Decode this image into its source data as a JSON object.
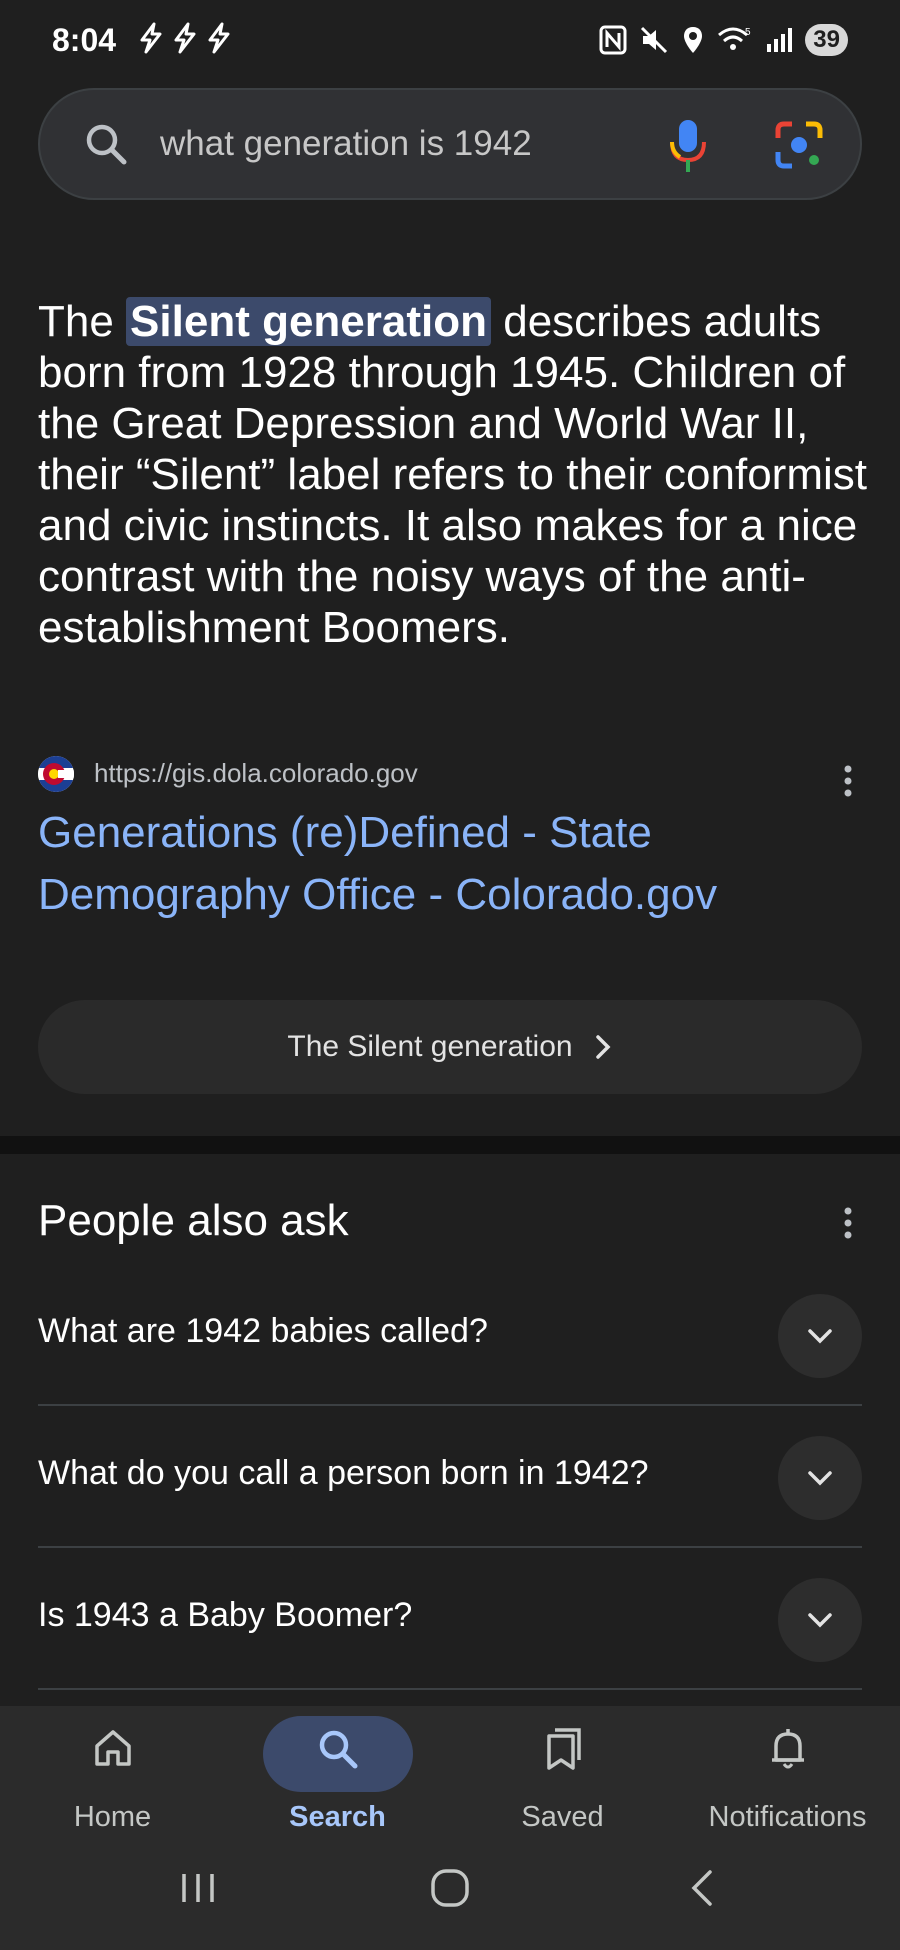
{
  "status_bar": {
    "time": "8:04",
    "battery": "39"
  },
  "search": {
    "query": "what generation is 1942"
  },
  "answer": {
    "before": "The ",
    "highlight": "Silent generation",
    "after": " describes adults born from 1928 through 1945. Children of the Great Depression and World War II, their “Silent” label refers to their conformist and civic instincts. It also makes for a nice contrast with the noisy ways of the anti-establishment Boomers."
  },
  "source": {
    "url": "https://gis.dola.colorado.gov",
    "title": "Generations (re)Defined - State Demography Office - Colorado.gov"
  },
  "chip": {
    "label": "The Silent generation"
  },
  "people_also_ask": {
    "title": "People also ask",
    "questions": [
      "What are 1942 babies called?",
      "What do you call a person born in 1942?",
      "Is 1943 a Baby Boomer?"
    ]
  },
  "bottom_nav": {
    "items": [
      {
        "label": "Home",
        "icon": "home-icon"
      },
      {
        "label": "Search",
        "icon": "search-icon",
        "active": true
      },
      {
        "label": "Saved",
        "icon": "saved-icon"
      },
      {
        "label": "Notifications",
        "icon": "bell-icon"
      }
    ]
  },
  "colors": {
    "background": "#1f1f1f",
    "link": "#8ab4f8",
    "highlight": "#3c4a6b",
    "active_nav": "#a8c7fa"
  }
}
